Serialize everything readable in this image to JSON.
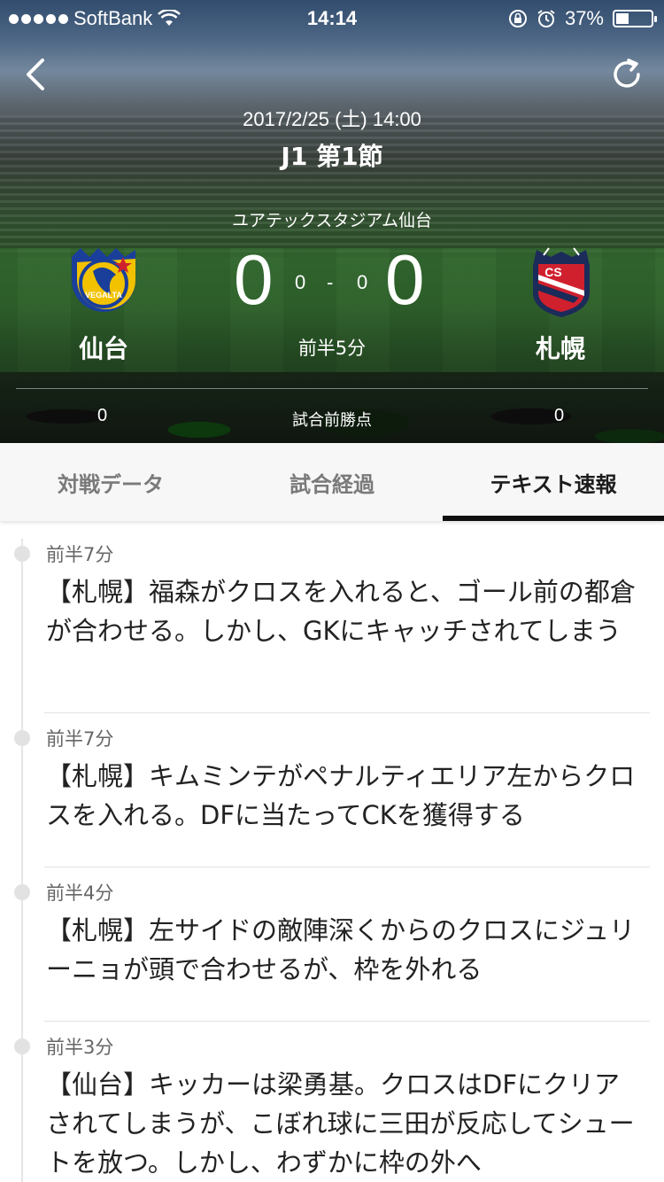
{
  "status_bar": {
    "carrier": "SoftBank",
    "time": "14:14",
    "battery": "37%",
    "battery_level": 0.37
  },
  "match": {
    "date": "2017/2/25 (土) 14:00",
    "round": "J1 第1節",
    "venue": "ユアテックスタジアム仙台",
    "home": {
      "name": "仙台",
      "score": "0",
      "logo_text": "VEGALTA",
      "colors": [
        "#1a3f9b",
        "#f2c200"
      ]
    },
    "away": {
      "name": "札幌",
      "score": "0",
      "logo_text": "CONSADOLE SAPPORO",
      "colors": [
        "#d0202e",
        "#1b2b5a"
      ]
    },
    "half_home": "0",
    "half_sep": "-",
    "half_away": "0",
    "elapsed": "前半5分",
    "pre_points_label": "試合前勝点",
    "pre_points_home": "0",
    "pre_points_away": "0"
  },
  "tabs": [
    {
      "label": "対戦データ",
      "active": false
    },
    {
      "label": "試合経過",
      "active": false
    },
    {
      "label": "テキスト速報",
      "active": true
    }
  ],
  "feed": [
    {
      "time": "前半7分",
      "text": "【札幌】福森がクロスを入れると、ゴール前の都倉が合わせる。しかし、GKにキャッチされてしまう"
    },
    {
      "time": "前半7分",
      "text": "【札幌】キムミンテがペナルティエリア左からクロスを入れる。DFに当たってCKを獲得する"
    },
    {
      "time": "前半4分",
      "text": "【札幌】左サイドの敵陣深くからのクロスにジュリーニョが頭で合わせるが、枠を外れる"
    },
    {
      "time": "前半3分",
      "text": "【仙台】キッカーは梁勇基。クロスはDFにクリアされてしまうが、こぼれ球に三田が反応してシュートを放つ。しかし、わずかに枠の外へ"
    }
  ]
}
